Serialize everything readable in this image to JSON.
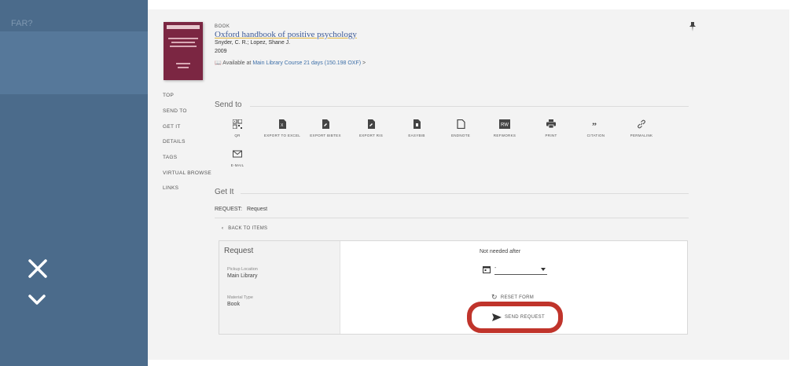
{
  "overlay": {
    "ghost_text": "FAR?"
  },
  "record": {
    "type": "BOOK",
    "title": "Oxford handbook of positive psychology",
    "authors": "Snyder, C. R.; Lopez, Shane J.",
    "year": "2009",
    "availability_prefix": "Available at",
    "library": "Main Library",
    "availability_detail": "Course 21 days (150.198 OXF)",
    "chevron": ">",
    "cover_title": "Oxford Handbook of Positive Psychology"
  },
  "nav": {
    "items": [
      "TOP",
      "SEND TO",
      "GET IT",
      "DETAILS",
      "TAGS",
      "VIRTUAL BROWSE",
      "LINKS"
    ]
  },
  "send_to": {
    "title": "Send to",
    "items": [
      {
        "label": "QR",
        "icon": "qr-code-icon"
      },
      {
        "label": "EXPORT TO EXCEL",
        "icon": "excel-icon"
      },
      {
        "label": "EXPORT BIBTEX",
        "icon": "bibtex-icon"
      },
      {
        "label": "EXPORT RIS",
        "icon": "ris-icon"
      },
      {
        "label": "EASYBIB",
        "icon": "easybib-icon"
      },
      {
        "label": "ENDNOTE",
        "icon": "endnote-icon"
      },
      {
        "label": "REFWORKS",
        "icon": "refworks-icon"
      },
      {
        "label": "PRINT",
        "icon": "print-icon"
      },
      {
        "label": "CITATION",
        "icon": "quote-icon"
      },
      {
        "label": "PERMALINK",
        "icon": "link-icon"
      },
      {
        "label": "E-MAIL",
        "icon": "email-icon"
      }
    ]
  },
  "get_it": {
    "title": "Get It",
    "request_label": "REQUEST:",
    "request_value": "Request",
    "back_label": "BACK TO ITEMS"
  },
  "form": {
    "title": "Request",
    "pickup_label": "Pickup Location",
    "pickup_value": "Main Library",
    "material_label": "Material Type",
    "material_value": "Book",
    "not_needed_label": "Not needed after",
    "date_value": "-",
    "reset_label": "RESET FORM",
    "send_label": "SEND REQUEST",
    "highlight_color": "#c0342b"
  }
}
